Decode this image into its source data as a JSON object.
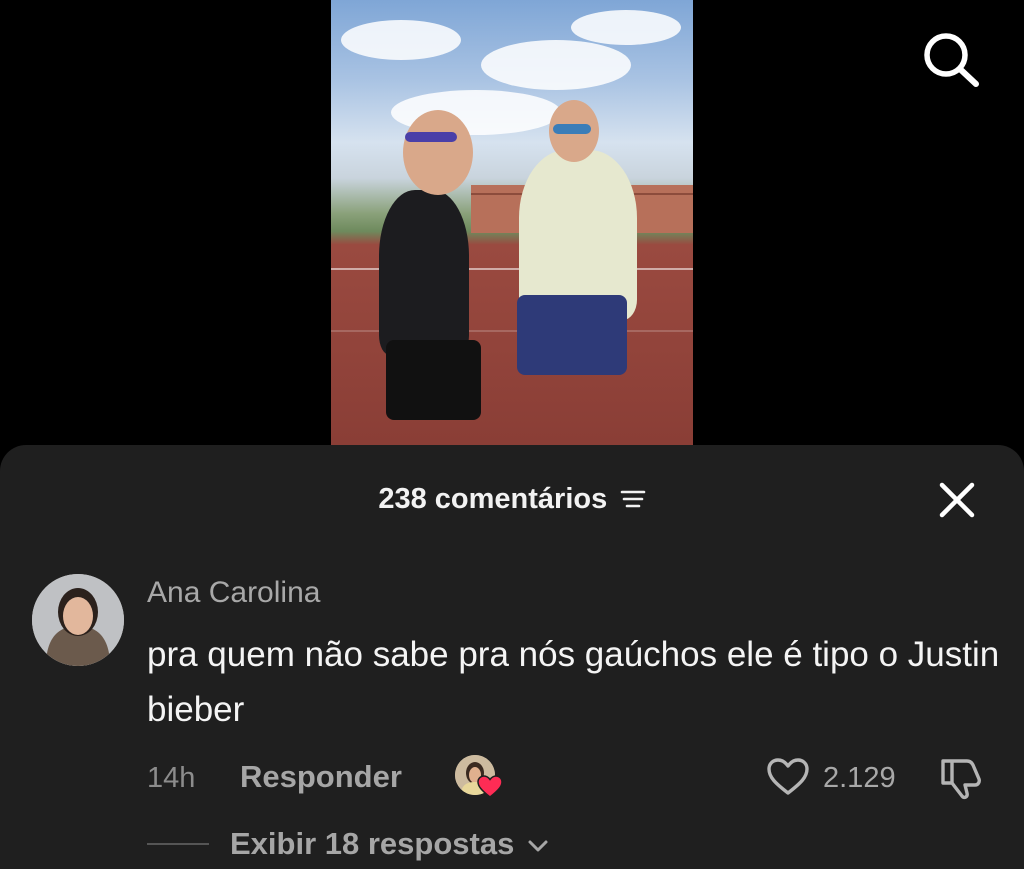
{
  "video": {
    "description_icon": "video-thumbnail"
  },
  "top_bar": {
    "search_icon": "search-icon"
  },
  "comments_sheet": {
    "title": "238 comentários",
    "sort_icon": "sort-lines-icon",
    "close_icon": "close-icon"
  },
  "comment": {
    "author": "Ana Carolina",
    "text": "pra quem não sabe pra nós gaúchos ele é tipo o Justin bieber",
    "time": "14h",
    "reply_label": "Responder",
    "creator_liked_icon": "creator-heart-icon",
    "like_count": "2.129",
    "view_replies_label": "Exibir 18 respostas"
  },
  "colors": {
    "sheet_bg": "#1f1f1f",
    "heart_red": "#fe2c55",
    "muted_text": "#a8a8a8"
  }
}
